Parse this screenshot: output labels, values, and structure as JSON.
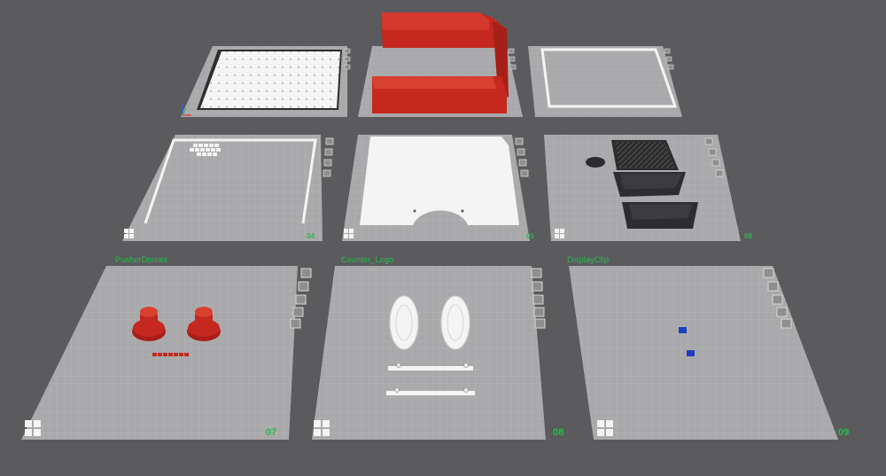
{
  "colors": {
    "background": "#5b5b5d",
    "plate": "#a9a9ab",
    "grid": "#c4c4c6",
    "label_green": "#20c24a",
    "model_red": "#c4281f",
    "model_white": "#f2f2f2",
    "model_dark": "#2d2d2f",
    "model_blue": "#1f3fbf"
  },
  "plates": [
    {
      "number": "",
      "name": "",
      "icon": "plate-icon"
    },
    {
      "number": "",
      "name": "",
      "icon": "plate-icon"
    },
    {
      "number": "",
      "name": "",
      "icon": "plate-icon"
    },
    {
      "number": "04",
      "name": "",
      "icon": "plate-icon"
    },
    {
      "number": "05",
      "name": "",
      "icon": "plate-icon"
    },
    {
      "number": "06",
      "name": "",
      "icon": "plate-icon"
    },
    {
      "number": "07",
      "name": "PusherDomes",
      "icon": "plate-icon"
    },
    {
      "number": "08",
      "name": "Counter_Logo",
      "icon": "plate-icon"
    },
    {
      "number": "09",
      "name": "DisplayClip",
      "icon": "plate-icon"
    }
  ],
  "plate_tool_icons": [
    "close-icon",
    "auto-orient-icon",
    "arrange-icon",
    "lock-icon",
    "settings-icon"
  ]
}
